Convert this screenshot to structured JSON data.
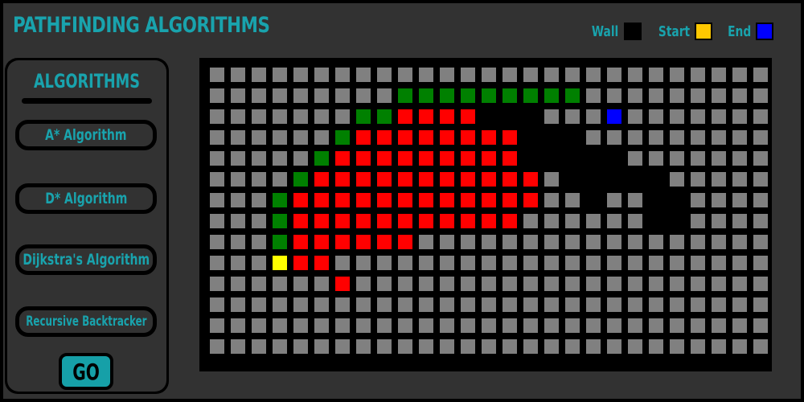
{
  "app": {
    "title": "PATHFINDING ALGORITHMS"
  },
  "legend": [
    {
      "label": "Wall",
      "color": "#000000"
    },
    {
      "label": "Start",
      "color": "#ffc800"
    },
    {
      "label": "End",
      "color": "#0000ff"
    }
  ],
  "sidebar": {
    "heading": "ALGORITHMS",
    "buttons": [
      {
        "label": "A* Algorithm"
      },
      {
        "label": "D* Algorithm"
      },
      {
        "label": "Dijkstra's Algorithm"
      },
      {
        "label": "Recursive Backtracker"
      }
    ],
    "go_label": "GO"
  },
  "grid": {
    "rows": 14,
    "cols": 27,
    "colors": {
      "empty": "#808080",
      "wall": "#000000",
      "visited": "#ff0000",
      "frontier": "#008000",
      "start": "#ffff00",
      "end": "#0000ff"
    },
    "cells": [
      "...........................",
      ".........GGGGGGGGG.........",
      ".......GGRRRR###...E.......",
      "......GRRRRRRRR###.........",
      ".....GRRRRRRRRR#####.......",
      "....GRRRRRRRRRRR.#####.....",
      "...GRRRRRRRRRRRR..#..##....",
      "...GRRRRRRRRRRR......##....",
      "...GRRRRRR.................",
      "...SRR.....................",
      "......R....................",
      "...........................",
      "...........................",
      "..........................."
    ]
  }
}
